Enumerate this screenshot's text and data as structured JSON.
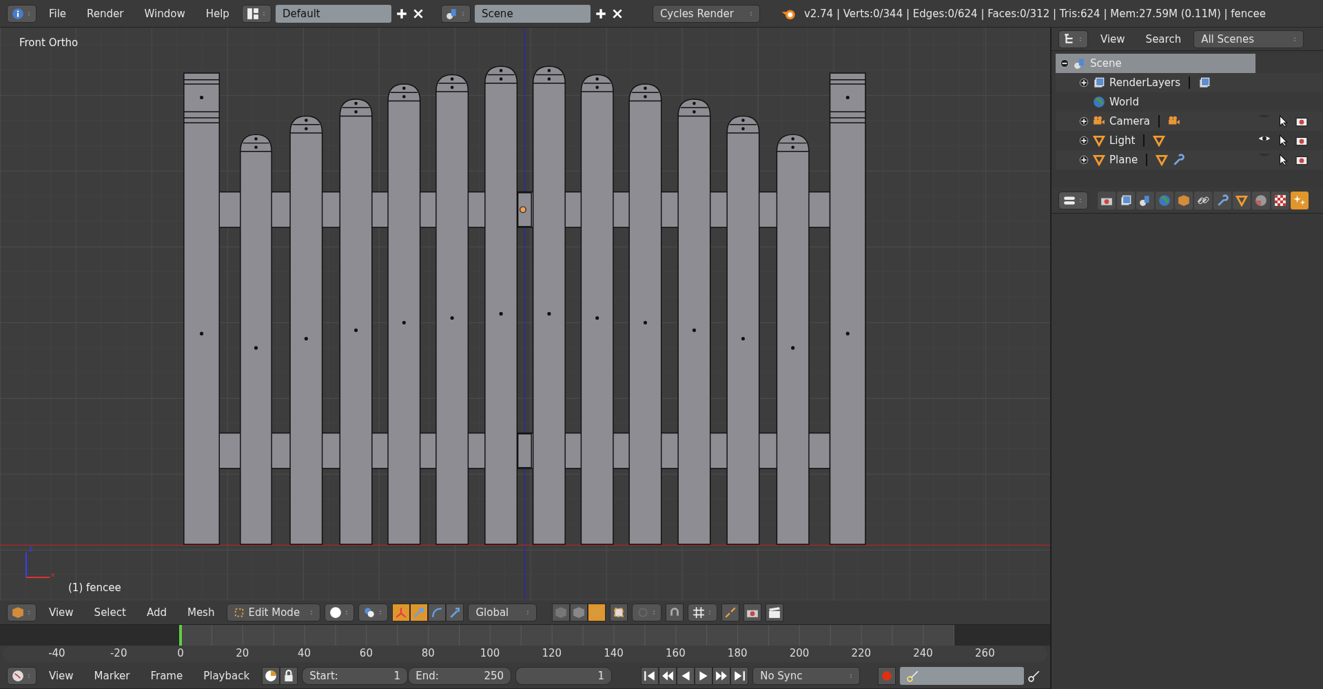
{
  "top_bar": {
    "menus": [
      "File",
      "Render",
      "Window",
      "Help"
    ],
    "screen_layout": "Default",
    "scene": "Scene",
    "render_engine": "Cycles Render",
    "stats": "v2.74 | Verts:0/344 | Edges:0/624 | Faces:0/312 | Tris:624 | Mem:27.59M (0.11M) | fencee"
  },
  "viewport": {
    "view_name": "Front Ortho",
    "object_label": "(1) fencee"
  },
  "viewport_header": {
    "menus": [
      "View",
      "Select",
      "Add",
      "Mesh"
    ],
    "mode": "Edit Mode",
    "orientation": "Global",
    "manipulators": [
      {
        "kind": "translate",
        "selected": true
      },
      {
        "kind": "rotate",
        "selected": false
      },
      {
        "kind": "scale",
        "selected": false
      }
    ],
    "select_modes": [
      {
        "kind": "vertex",
        "selected": false
      },
      {
        "kind": "edge",
        "selected": false
      },
      {
        "kind": "face",
        "selected": true
      }
    ]
  },
  "timeline": {
    "ticks": [
      "-40",
      "-20",
      "0",
      "20",
      "40",
      "60",
      "80",
      "100",
      "120",
      "140",
      "160",
      "180",
      "200",
      "220",
      "240",
      "260"
    ]
  },
  "timeline_header": {
    "menus": [
      "View",
      "Marker",
      "Frame",
      "Playback"
    ],
    "start_label": "Start:",
    "start": "1",
    "end_label": "End:",
    "end": "250",
    "current_frame": "1",
    "sync": "No Sync"
  },
  "outliner": {
    "menus": [
      "View",
      "Search"
    ],
    "display_mode": "All Scenes",
    "tree": [
      {
        "name": "Scene",
        "kind": "scene",
        "selected": true,
        "expanded": true,
        "children": [
          {
            "name": "RenderLayers",
            "kind": "renderlayers",
            "selected": false,
            "expanded": false,
            "data": [
              {
                "kind": "renderlayers"
              }
            ]
          },
          {
            "name": "World",
            "kind": "world",
            "selected": false
          },
          {
            "name": "Camera",
            "kind": "camera",
            "selected": false,
            "expanded": false,
            "visible": false,
            "data": [
              {
                "kind": "camera"
              }
            ]
          },
          {
            "name": "Light",
            "kind": "mesh",
            "selected": false,
            "expanded": false,
            "visible": true,
            "data": [
              {
                "kind": "mesh"
              }
            ]
          },
          {
            "name": "Plane",
            "kind": "mesh",
            "selected": false,
            "expanded": false,
            "visible": false,
            "data": [
              {
                "kind": "mesh"
              },
              {
                "kind": "modifier"
              }
            ]
          }
        ]
      }
    ]
  },
  "properties": {
    "tabs": [
      {
        "kind": "render",
        "selected": false
      },
      {
        "kind": "renderlayers",
        "selected": false
      },
      {
        "kind": "scene",
        "selected": false
      },
      {
        "kind": "world",
        "selected": false
      },
      {
        "kind": "object",
        "selected": false
      },
      {
        "kind": "constraint",
        "selected": false
      },
      {
        "kind": "modifier",
        "selected": false
      },
      {
        "kind": "mesh",
        "selected": false
      },
      {
        "kind": "material",
        "selected": false
      },
      {
        "kind": "texture",
        "selected": false
      },
      {
        "kind": "particles",
        "selected": true
      }
    ]
  }
}
